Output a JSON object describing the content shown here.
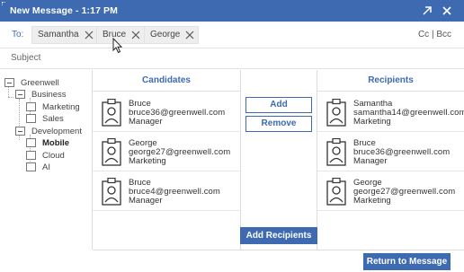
{
  "window": {
    "title": "New Message - 1:17 PM",
    "expand_icon": "expand-icon",
    "close_icon": "close-icon",
    "accent": "#3d6ab1"
  },
  "to": {
    "label": "To:",
    "chips": [
      {
        "name": "Samantha"
      },
      {
        "name": "Bruce"
      },
      {
        "name": "George"
      }
    ],
    "cc_bcc": "Cc | Bcc"
  },
  "subject": {
    "placeholder": "Subject"
  },
  "tree": {
    "nodes": [
      {
        "label": "Greenwell",
        "icon": "minus-box"
      },
      {
        "label": "Business",
        "icon": "minus-box"
      },
      {
        "label": "Marketing",
        "icon": "box"
      },
      {
        "label": "Sales",
        "icon": "box"
      },
      {
        "label": "Development",
        "icon": "minus-box"
      },
      {
        "label": "Mobile",
        "icon": "box",
        "selected": true
      },
      {
        "label": "Cloud",
        "icon": "box"
      },
      {
        "label": "AI",
        "icon": "box"
      }
    ]
  },
  "candidates": {
    "header": "Candidates",
    "items": [
      {
        "name": "Bruce",
        "email": "bruce36@greenwell.com",
        "role": "Manager"
      },
      {
        "name": "George",
        "email": "george27@greenwell.com",
        "role": "Marketing"
      },
      {
        "name": "Bruce",
        "email": "bruce4@greenwell.com",
        "role": "Manager"
      }
    ]
  },
  "actions": {
    "add": "Add",
    "remove": "Remove",
    "add_recipients": "Add Recipients",
    "return": "Return to Message"
  },
  "recipients": {
    "header": "Recipients",
    "items": [
      {
        "name": "Samantha",
        "email": "samantha14@greenwell.com",
        "role": "Marketing"
      },
      {
        "name": "Bruce",
        "email": "bruce36@greenwell.com",
        "role": "Manager"
      },
      {
        "name": "George",
        "email": "george27@greenwell.com",
        "role": "Marketing"
      }
    ]
  }
}
